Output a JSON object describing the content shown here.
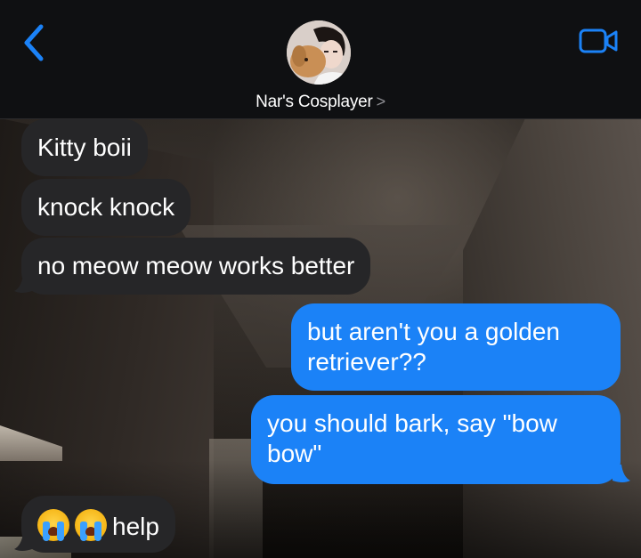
{
  "header": {
    "contact_name": "Nar's Cosplayer",
    "contact_chevron": ">",
    "back_icon": "chevron-left-icon",
    "video_icon": "video-camera-icon",
    "accent_color": "#1b82f7"
  },
  "messages": [
    {
      "direction": "incoming",
      "text": "Kitty boii"
    },
    {
      "direction": "incoming",
      "text": "knock knock"
    },
    {
      "direction": "incoming",
      "text": "no meow meow works better"
    },
    {
      "direction": "outgoing",
      "text": "but aren't you a golden retriever??"
    },
    {
      "direction": "outgoing",
      "text": "you should bark, say \"bow bow\""
    },
    {
      "direction": "incoming",
      "text": "help",
      "emoji": "😭😭"
    }
  ],
  "colors": {
    "incoming_bubble": "#262628",
    "outgoing_bubble": "#1b82f7",
    "header_bg": "#0f1012"
  }
}
